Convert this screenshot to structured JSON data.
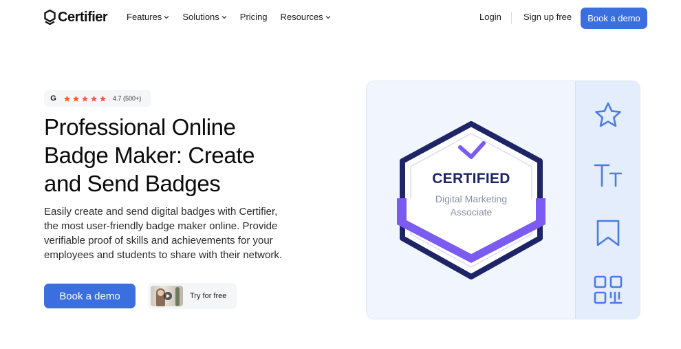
{
  "brand": {
    "name": "Certifier"
  },
  "nav": {
    "items": [
      {
        "label": "Features",
        "has_dropdown": true
      },
      {
        "label": "Solutions",
        "has_dropdown": true
      },
      {
        "label": "Pricing",
        "has_dropdown": false
      },
      {
        "label": "Resources",
        "has_dropdown": true
      }
    ],
    "login": "Login",
    "signup": "Sign up free",
    "book_demo": "Book a demo"
  },
  "hero": {
    "rating": {
      "platform_icon": "G",
      "stars": 5,
      "text": "4.7 (500+)"
    },
    "headline_lines": [
      "Professional Online",
      "Badge Maker: Create",
      "and Send Badges"
    ],
    "description_lines": [
      "Easily create and send digital badges with Certifier,",
      "the most user-friendly badge maker online. Provide",
      "verifiable proof of skills and achievements for your",
      "employees and students to share with their network."
    ],
    "primary_cta": "Book a demo",
    "secondary_cta": "Try for free"
  },
  "badge": {
    "title": "CERTIFIED",
    "subtitle_lines": [
      "Digital Marketing",
      "Associate"
    ]
  },
  "editor_rail": {
    "icons": [
      "star-icon",
      "text-icon",
      "bookmark-icon",
      "qr-code-icon"
    ]
  },
  "colors": {
    "primary": "#3b6fe0",
    "badge_navy": "#1d2566",
    "badge_purple": "#7c5cf0",
    "rating_star": "#ef5a3c",
    "rail_icon": "#4a7be6"
  }
}
